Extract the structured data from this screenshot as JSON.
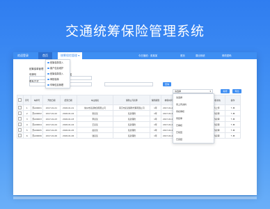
{
  "hero": {
    "title": "交通统筹保险管理系统"
  },
  "topbar": {
    "brand": "欢迎登录",
    "home": "首页",
    "menu": "统筹保险管理",
    "right_items": [
      "今日值班：张某某",
      "首页",
      "退出系统",
      "修改密码"
    ]
  },
  "dropdown": {
    "items": [
      "统筹保单录入",
      "客户信息维护",
      "统筹保单录入",
      "审核保单",
      "车辆信息管理"
    ]
  },
  "form": {
    "section_title": "统筹保单管理",
    "fields": [
      {
        "label": "车牌号",
        "placeholder": ""
      },
      {
        "label": "车主姓名",
        "placeholder": ""
      },
      {
        "label": "联系方式",
        "placeholder": ""
      },
      {
        "label": "开始日期",
        "placeholder": ""
      },
      {
        "label": "结束日期",
        "placeholder": ""
      }
    ],
    "search_button": "查询",
    "select_value": "请选择",
    "add_button": "新增",
    "export_button": "导出"
  },
  "select_options": [
    "请选择",
    "待上传资料",
    "待初审核",
    "待复审",
    "已审核",
    "已驳回",
    "已完结"
  ],
  "table": {
    "headers": [
      "",
      "序号",
      "车牌号",
      "开始日期",
      "结束日期",
      "车主姓名",
      "保险公司名称",
      "保险期限",
      "参保时间",
      "到期时间",
      "统筹保额(元)",
      "审核状态",
      "操作"
    ],
    "rows": [
      [
        "",
        "1",
        "苏A00001",
        "2017-01-01",
        "2018-01-01",
        "常州市某某物流有限公司",
        "南京市某某保险代理有限公司",
        "1年",
        "2017-01-01",
        "2018-01-01",
        "10000",
        "待上传",
        "✎ ✖"
      ],
      [
        "",
        "2",
        "苏A00002",
        "2017-01-02",
        "2018-01-02",
        "张某某",
        "某某保险",
        "1年",
        "2017-01-02",
        "2018-01-02",
        "8000",
        "待初审",
        "✎ ✖"
      ],
      [
        "",
        "3",
        "苏A00003",
        "2017-01-03",
        "2018-01-03",
        "李某某",
        "某某保险",
        "1年",
        "2017-01-03",
        "2018-01-03",
        "8000",
        "待初审",
        "✎ ✖"
      ],
      [
        "",
        "4",
        "苏A00004",
        "2017-01-04",
        "2018-01-04",
        "王某某",
        "某某保险",
        "1年",
        "2017-01-04",
        "2018-01-04",
        "8000",
        "待初审",
        "✎ ✖"
      ],
      [
        "",
        "5",
        "苏A00005",
        "2017-01-05",
        "2018-01-05",
        "赵某某",
        "某某保险",
        "1年",
        "2017-01-05",
        "2018-01-05",
        "8000",
        "待初审",
        "✎ ✖"
      ],
      [
        "",
        "6",
        "苏A00006",
        "2017-01-06",
        "2018-01-06",
        "钱某某",
        "某某保险",
        "1年",
        "2017-01-06",
        "2018-01-06",
        "8000",
        "待初审",
        "✎ ✖"
      ]
    ]
  },
  "colors": {
    "accent": "#3e8ef2",
    "header_bg": "#f1f4f8"
  }
}
